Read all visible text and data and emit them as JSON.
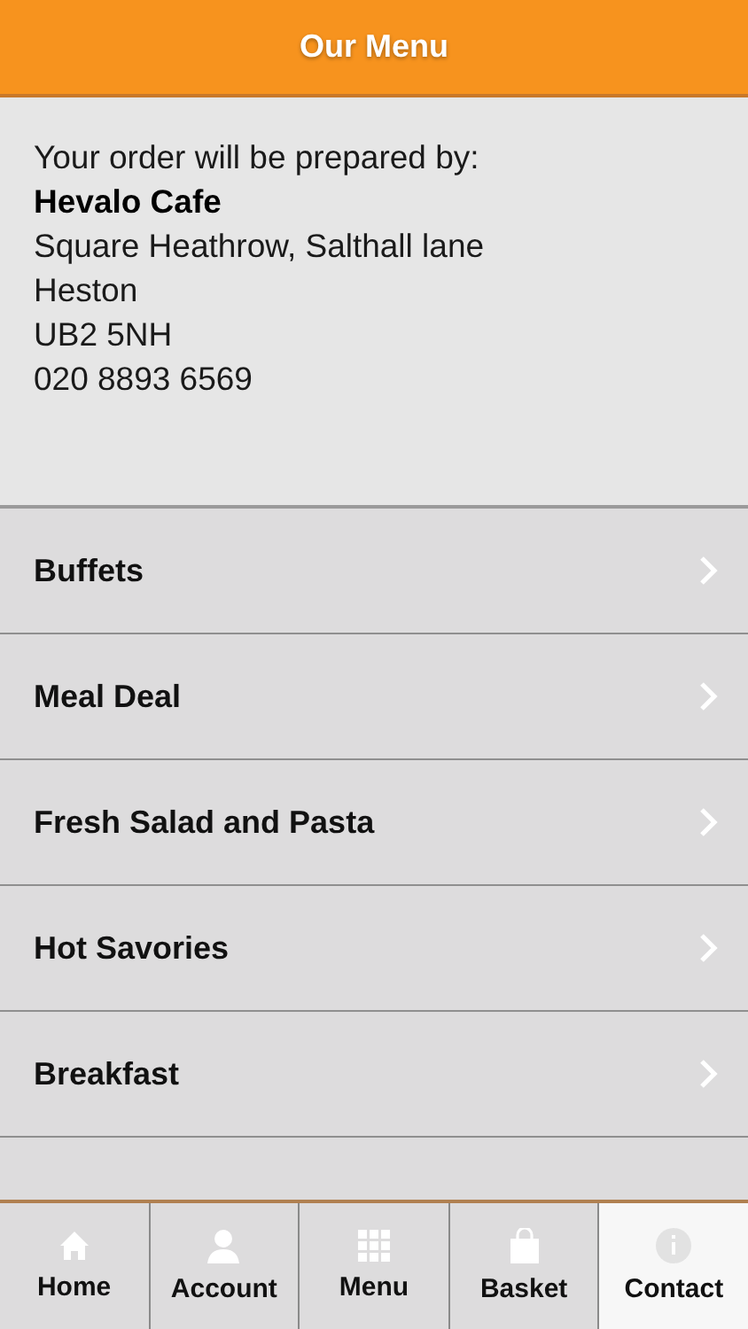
{
  "header": {
    "title": "Our Menu"
  },
  "info": {
    "intro": "Your order will be prepared by:",
    "name": "Hevalo Cafe",
    "address": [
      "Square Heathrow, Salthall lane",
      "Heston",
      "UB2 5NH"
    ],
    "phone": "020 8893 6569"
  },
  "categories": [
    {
      "label": "Buffets"
    },
    {
      "label": "Meal Deal"
    },
    {
      "label": "Fresh Salad and Pasta"
    },
    {
      "label": "Hot Savories"
    },
    {
      "label": "Breakfast"
    }
  ],
  "tabs": [
    {
      "label": "Home",
      "kind": "home",
      "selected": false
    },
    {
      "label": "Account",
      "kind": "person",
      "selected": false
    },
    {
      "label": "Menu",
      "kind": "grid",
      "selected": false
    },
    {
      "label": "Basket",
      "kind": "bag",
      "selected": false
    },
    {
      "label": "Contact",
      "kind": "info",
      "selected": true
    }
  ]
}
